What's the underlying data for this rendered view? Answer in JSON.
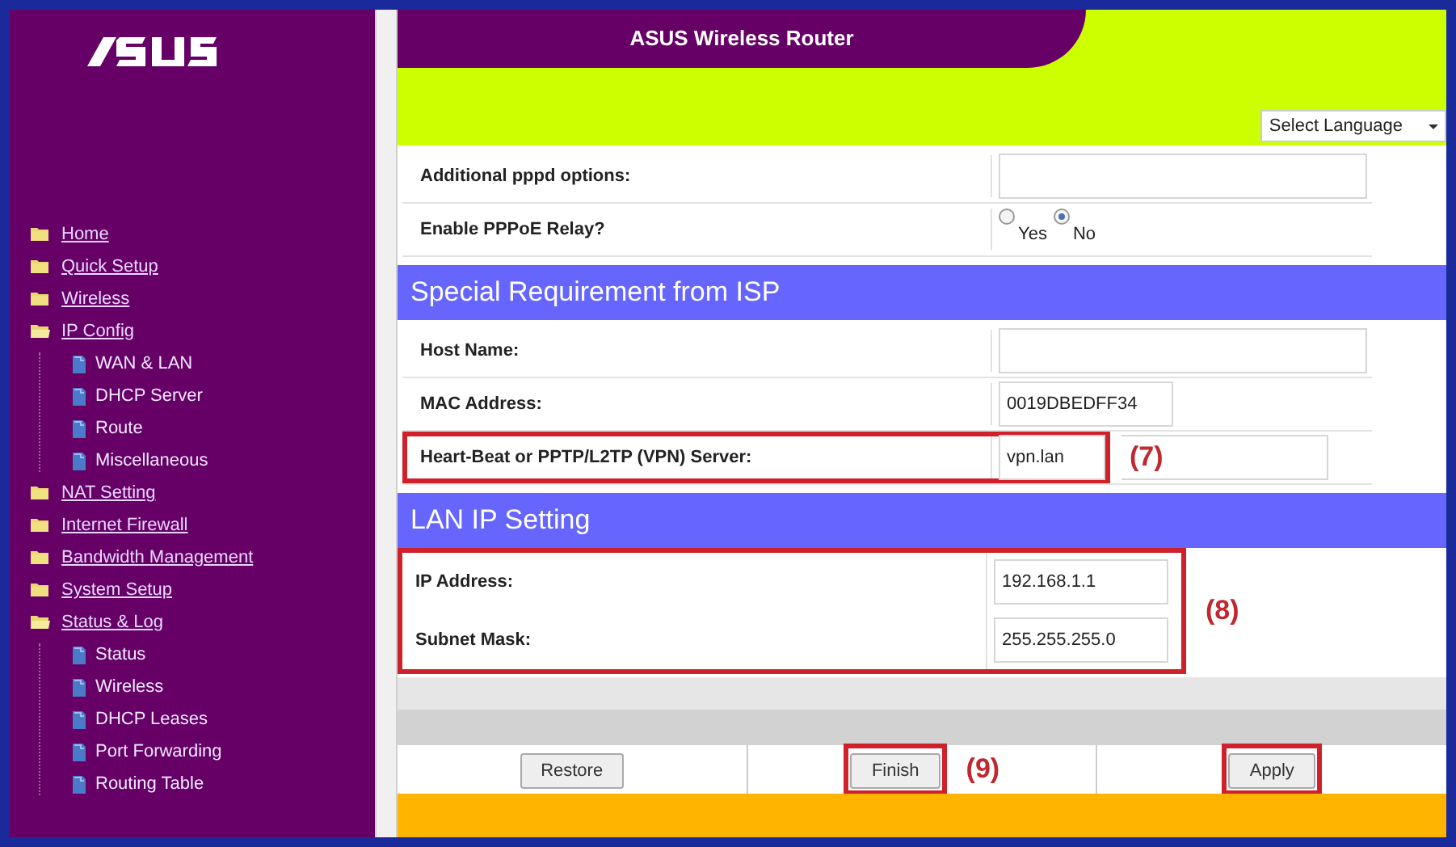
{
  "sidebar": {
    "items": [
      {
        "label": "Home",
        "expanded": false
      },
      {
        "label": "Quick Setup",
        "expanded": false
      },
      {
        "label": "Wireless",
        "expanded": false
      },
      {
        "label": "IP Config",
        "expanded": true,
        "children": [
          {
            "label": "WAN & LAN"
          },
          {
            "label": "DHCP Server"
          },
          {
            "label": "Route"
          },
          {
            "label": "Miscellaneous"
          }
        ]
      },
      {
        "label": "NAT Setting",
        "expanded": false
      },
      {
        "label": "Internet Firewall",
        "expanded": false
      },
      {
        "label": "Bandwidth Management",
        "expanded": false
      },
      {
        "label": "System Setup",
        "expanded": false
      },
      {
        "label": "Status & Log",
        "expanded": true,
        "children": [
          {
            "label": "Status"
          },
          {
            "label": "Wireless"
          },
          {
            "label": "DHCP Leases"
          },
          {
            "label": "Port Forwarding"
          },
          {
            "label": "Routing Table"
          }
        ]
      }
    ]
  },
  "header": {
    "title": "ASUS Wireless Router",
    "language_select": "Select Language"
  },
  "sections": [
    {
      "rows": [
        {
          "kind": "text",
          "label": "Additional pppd options:",
          "value": "",
          "highlighted": false
        },
        {
          "kind": "radio",
          "label": "Enable PPPoE Relay?",
          "options": [
            {
              "label": "Yes",
              "selected": false
            },
            {
              "label": "No",
              "selected": true
            }
          ],
          "highlighted": false
        }
      ],
      "highlighted": false
    },
    {
      "title": "Special Requirement from ISP",
      "rows": [
        {
          "kind": "text",
          "label": "Host Name:",
          "value": "",
          "highlighted": false
        },
        {
          "kind": "short",
          "label": "MAC Address:",
          "value": "0019DBEDFF34",
          "highlighted": false
        },
        {
          "kind": "text",
          "label": "Heart-Beat or PPTP/L2TP (VPN) Server:",
          "value": "vpn.lan",
          "highlighted": true,
          "callout": "(7)"
        }
      ],
      "highlighted": false
    },
    {
      "title": "LAN IP Setting",
      "rows": [
        {
          "kind": "short",
          "label": "IP Address:",
          "value": "192.168.1.1"
        },
        {
          "kind": "short",
          "label": "Subnet Mask:",
          "value": "255.255.255.0"
        }
      ],
      "highlighted": true,
      "callout": "(8)"
    }
  ],
  "buttons": [
    {
      "label": "Restore",
      "highlighted": false
    },
    {
      "label": "Finish",
      "highlighted": true,
      "callout": "(9)"
    },
    {
      "label": "Apply",
      "highlighted": true
    }
  ]
}
